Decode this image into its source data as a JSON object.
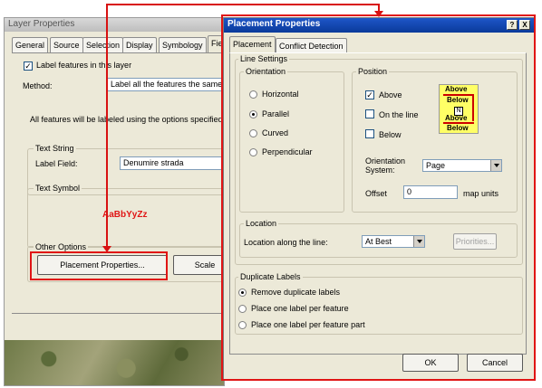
{
  "layer_dialog": {
    "title": "Layer Properties",
    "tabs": [
      "General",
      "Source",
      "Selection",
      "Display",
      "Symbology",
      "Fie"
    ],
    "label_features_text": "Label features in this layer",
    "method_label": "Method:",
    "method_value": "Label all the features the same w",
    "info_text": "All features will be labeled using the options specified.",
    "text_string_group": "Text String",
    "label_field_label": "Label Field:",
    "label_field_value": "Denumire strada",
    "text_symbol_group": "Text Symbol",
    "symbol_preview": "AaBbYyZz",
    "other_options_group": "Other Options",
    "placement_button": "Placement Properties...",
    "scale_button": "Scale"
  },
  "placement_dialog": {
    "title": "Placement Properties",
    "help_glyph": "?",
    "close_glyph": "X",
    "tabs": [
      "Placement",
      "Conflict Detection"
    ],
    "line_settings_group": "Line Settings",
    "orientation_group": "Orientation",
    "orientation_options": [
      "Horizontal",
      "Parallel",
      "Curved",
      "Perpendicular"
    ],
    "orientation_selected": "Parallel",
    "position_group": "Position",
    "position_above": "Above",
    "position_on_the_line": "On the line",
    "position_below": "Below",
    "preview_labels": [
      "Above",
      "Below",
      "Above",
      "Below"
    ],
    "preview_marker": "N",
    "orientation_system_label": "Orientation\nSystem:",
    "orientation_system_value": "Page",
    "offset_label": "Offset",
    "offset_value": "0",
    "offset_units": "map units",
    "location_group": "Location",
    "location_along_label": "Location along the line:",
    "location_along_value": "At Best",
    "priorities_button": "Priorities...",
    "duplicate_group": "Duplicate Labels",
    "duplicate_options": [
      "Remove duplicate labels",
      "Place one label per feature",
      "Place one label per feature part"
    ],
    "duplicate_selected": "Remove duplicate labels",
    "ok_button": "OK",
    "cancel_button": "Cancel"
  },
  "colors": {
    "annotation_red": "#e01515",
    "title_blue": "#0a3a9a",
    "preview_yellow": "#ffff66",
    "preview_red": "#cc0000"
  }
}
